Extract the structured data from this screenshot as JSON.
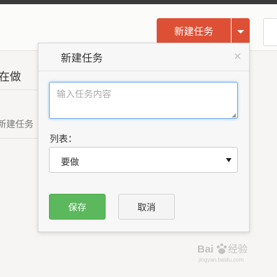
{
  "header": {
    "new_task_button": "新建任务"
  },
  "background": {
    "doing_label": "在做",
    "new_task_link": "新建任务"
  },
  "popover": {
    "title": "新建任务",
    "close_symbol": "×",
    "task_input_placeholder": "输入任务内容",
    "list_label": "列表：",
    "list_selected": "要做",
    "save_button": "保存",
    "cancel_button": "取消"
  },
  "colors": {
    "primary_red": "#de5036",
    "save_green": "#5cb85c",
    "focus_blue": "#6aa9e9"
  },
  "watermark": {
    "text": "Baidu 经验",
    "url_text": "jingyan.baidu.com"
  }
}
